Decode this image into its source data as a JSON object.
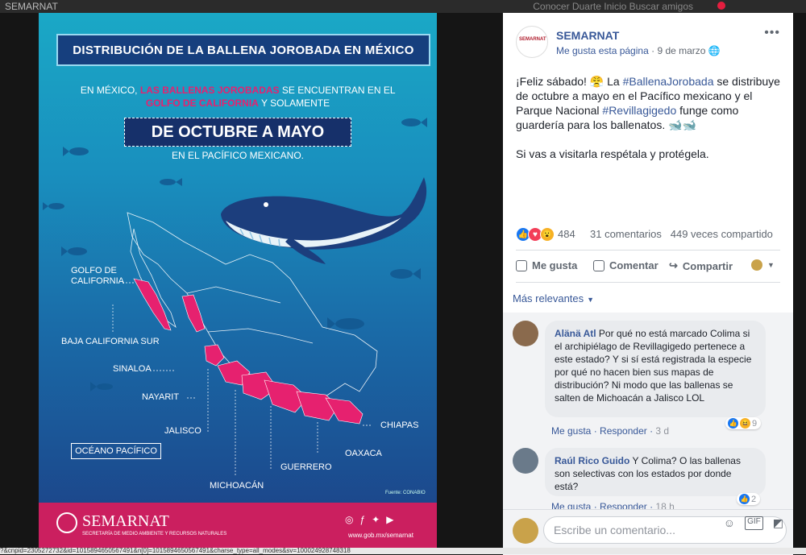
{
  "top_strip": {
    "left": "SEMARNAT",
    "right": "Conocer Duarte   Inicio   Buscar amigos"
  },
  "poster": {
    "title": "DISTRIBUCIÓN DE LA BALLENA JOROBADA EN MÉXICO",
    "intro_a": "EN MÉXICO,",
    "intro_hl1": "LAS BALLENAS JOROBADAS",
    "intro_b": "SE ENCUENTRAN EN EL",
    "intro_hl2": "GOLFO DE CALIFORNIA",
    "intro_c": "Y SOLAMENTE",
    "range": "DE OCTUBRE A MAYO",
    "range_sub": "EN EL PACÍFICO MEXICANO.",
    "labels": {
      "golfo": "GOLFO DE CALIFORNIA",
      "bcs": "BAJA CALIFORNIA SUR",
      "sinaloa": "SINALOA",
      "nayarit": "NAYARIT",
      "jalisco": "JALISCO",
      "michoacan": "MICHOACÁN",
      "guerrero": "GUERRERO",
      "oaxaca": "OAXACA",
      "chiapas": "CHIAPAS"
    },
    "ocean": "OCÉANO PACÍFICO",
    "fuente": "Fuente: CONABIO",
    "footer_brand": "SEMARNAT",
    "footer_tag": "SECRETARÍA DE MEDIO AMBIENTE Y RECURSOS NATURALES",
    "footer_site": "www.gob.mx/semarnat",
    "colors": {
      "highlight": "#e6216f",
      "footer": "#cb1f5f"
    }
  },
  "post": {
    "page_avatar_text": "SEMARNAT",
    "page_name": "SEMARNAT",
    "page_like": "Me gusta esta página",
    "date": "9 de marzo",
    "body_p1_a": "¡Feliz sábado! 😤 La",
    "hashtag1": "#BallenaJorobada",
    "body_p1_b": "se distribuye de octubre a mayo en el Pacífico mexicano y el Parque Nacional",
    "hashtag2": "#Revillagigedo",
    "body_p1_c": "funge como guardería para los ballenatos. 🐋🐋",
    "body_p2": "Si vas a visitarla respétala y protégela.",
    "reaction_count": "484",
    "comments_count": "31 comentarios",
    "shares": "449 veces compartido",
    "action_like": "Me gusta",
    "action_comment": "Comentar",
    "action_share": "Compartir",
    "sort_label": "Más relevantes"
  },
  "comments": [
    {
      "author": "Alänä Atl",
      "text": "Por qué no está marcado Colima si el archipiélago de Revillagigedo pertenece a este estado? Y si sí está registrada la especie por qué no hacen bien sus mapas de distribución? Ni modo que las ballenas se salten de Michoacán a Jalisco LOL",
      "like": "Me gusta",
      "reply": "Responder",
      "time": "3 d",
      "reactions": "9"
    },
    {
      "author": "Raúl Rico Guido",
      "text": "Y Colima? O las ballenas son selectivas con los estados por donde está?",
      "like": "Me gusta",
      "reply": "Responder",
      "time": "18 h",
      "reactions": "2"
    }
  ],
  "compose_placeholder": "Escribe un comentario...",
  "compose_gif": "GIF",
  "url_text": "?&cnpid=2305272732&id=1015894650567491&n[0]=1015894650567491&charse_type=all_modes&sv=100024928748318"
}
